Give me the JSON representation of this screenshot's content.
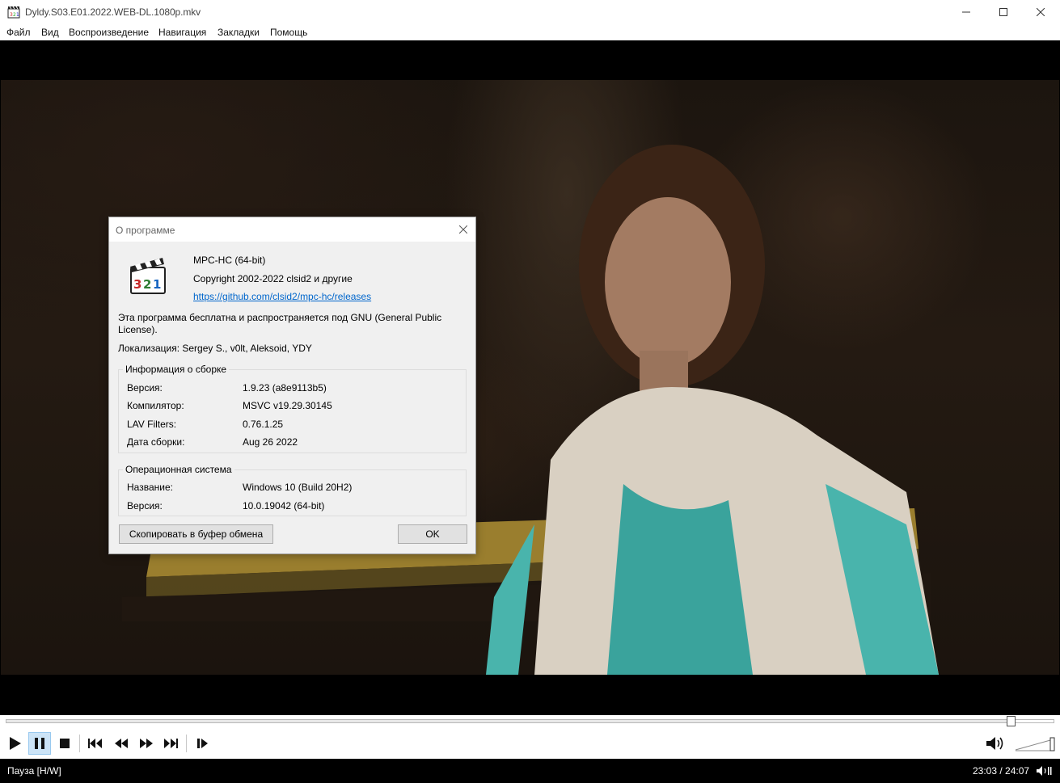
{
  "window": {
    "title": "Dyldy.S03.E01.2022.WEB-DL.1080p.mkv",
    "minimize_icon": "minimize-icon",
    "maximize_icon": "maximize-icon",
    "close_icon": "close-icon"
  },
  "menu": {
    "items": [
      "Файл",
      "Вид",
      "Воспроизведение",
      "Навигация",
      "Закладки",
      "Помощь"
    ]
  },
  "player": {
    "progress": 0.9592,
    "volume_icon": "speaker-icon",
    "controls": [
      "play-icon",
      "pause-icon",
      "stop-icon",
      "previous-icon",
      "rewind-icon",
      "fast-forward-icon",
      "next-icon",
      "frame-step-icon"
    ]
  },
  "status": {
    "text": "Пауза [H/W]",
    "time": "23:03 / 24:07"
  },
  "about_dialog": {
    "title": "О программе",
    "product": "MPC-HC (64-bit)",
    "copyright": "Copyright 2002-2022 clsid2 и другие",
    "link": "https://github.com/clsid2/mpc-hc/releases",
    "license_line1": "Эта программа бесплатна и распространяется под GNU (General Public",
    "license_line2": "License).",
    "localization": "Локализация: Sergey S., v0lt, Aleksoid, YDY",
    "build_info": {
      "label": "Информация о сборке",
      "rows": [
        {
          "key": "Версия:",
          "value": "1.9.23 (a8e9113b5)"
        },
        {
          "key": "Компилятор:",
          "value": "MSVC v19.29.30145"
        },
        {
          "key": "LAV Filters:",
          "value": "0.76.1.25"
        },
        {
          "key": "Дата сборки:",
          "value": "Aug 26 2022"
        }
      ]
    },
    "os_info": {
      "label": "Операционная система",
      "rows": [
        {
          "key": "Название:",
          "value": "Windows 10 (Build 20H2)"
        },
        {
          "key": "Версия:",
          "value": "10.0.19042 (64-bit)"
        }
      ]
    },
    "copy_button": "Скопировать в буфер обмена",
    "ok_button": "OK"
  }
}
